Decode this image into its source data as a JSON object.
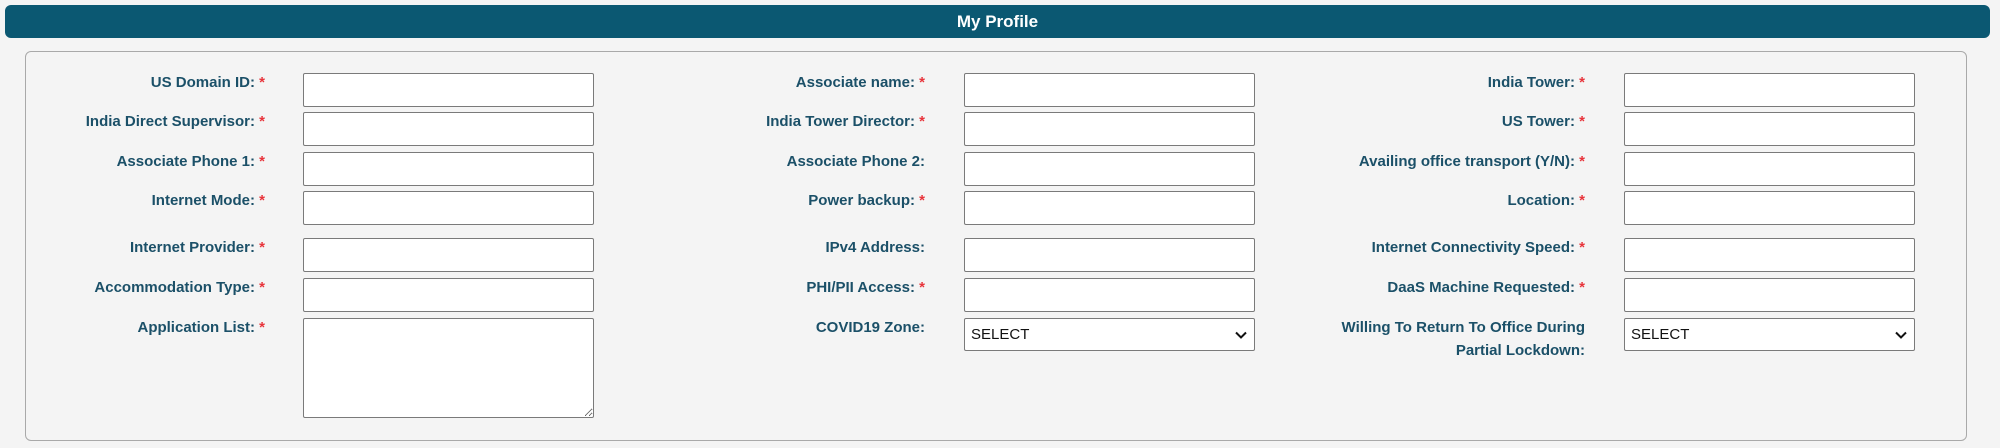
{
  "header": {
    "title": "My Profile"
  },
  "required_marker": "*",
  "form": {
    "columns": [
      {
        "fields": [
          {
            "label": "US Domain ID:",
            "required": true,
            "type": "text",
            "value": ""
          },
          {
            "label": "India Direct Supervisor:",
            "required": true,
            "type": "text",
            "value": ""
          },
          {
            "label": "Associate Phone 1:",
            "required": true,
            "type": "text",
            "value": ""
          },
          {
            "label": "Internet Mode:",
            "required": true,
            "type": "text",
            "value": ""
          },
          {
            "label": "Internet Provider:",
            "required": true,
            "type": "text",
            "value": ""
          },
          {
            "label": "Accommodation Type:",
            "required": true,
            "type": "text",
            "value": ""
          },
          {
            "label": "Application List:",
            "required": true,
            "type": "textarea",
            "value": ""
          }
        ]
      },
      {
        "fields": [
          {
            "label": "Associate name:",
            "required": true,
            "type": "text",
            "value": ""
          },
          {
            "label": "India Tower Director:",
            "required": true,
            "type": "text",
            "value": ""
          },
          {
            "label": "Associate Phone 2:",
            "required": false,
            "type": "text",
            "value": ""
          },
          {
            "label": "Power backup:",
            "required": true,
            "type": "text",
            "value": ""
          },
          {
            "label": "IPv4 Address:",
            "required": false,
            "type": "text",
            "value": ""
          },
          {
            "label": "PHI/PII Access:",
            "required": true,
            "type": "text",
            "value": ""
          },
          {
            "label": "COVID19 Zone:",
            "required": false,
            "type": "select",
            "value": "SELECT"
          }
        ]
      },
      {
        "fields": [
          {
            "label": "India Tower:",
            "required": true,
            "type": "text",
            "value": ""
          },
          {
            "label": "US Tower:",
            "required": true,
            "type": "text",
            "value": ""
          },
          {
            "label": "Availing office transport (Y/N):",
            "required": true,
            "type": "text",
            "value": ""
          },
          {
            "label": "Location:",
            "required": true,
            "type": "text",
            "value": ""
          },
          {
            "label": "Internet Connectivity Speed:",
            "required": true,
            "type": "text",
            "value": ""
          },
          {
            "label": "DaaS Machine Requested:",
            "required": true,
            "type": "text",
            "value": ""
          },
          {
            "label": "Willing To Return To Office During Partial Lockdown:",
            "required": false,
            "type": "select",
            "value": "SELECT"
          }
        ]
      }
    ]
  },
  "icons": {
    "dropdown": "chevron-down-icon"
  },
  "colors": {
    "header_bg": "#0b5872",
    "label_text": "#1b5068",
    "required_marker": "#e8333a",
    "page_bg": "#f4f4f4"
  }
}
